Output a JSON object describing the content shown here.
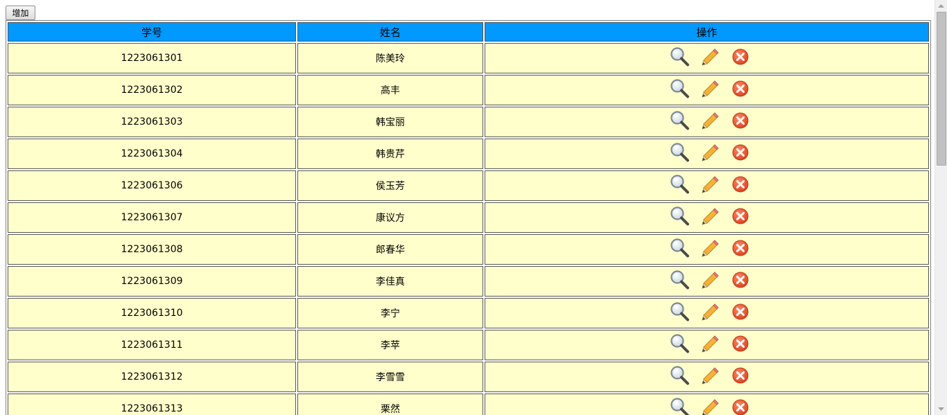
{
  "toolbar": {
    "add_label": "增加"
  },
  "table": {
    "columns": [
      "学号",
      "姓名",
      "操作"
    ],
    "rows": [
      {
        "id": "1223061301",
        "name": "陈美玲"
      },
      {
        "id": "1223061302",
        "name": "高丰"
      },
      {
        "id": "1223061303",
        "name": "韩宝丽"
      },
      {
        "id": "1223061304",
        "name": "韩贵芹"
      },
      {
        "id": "1223061306",
        "name": "侯玉芳"
      },
      {
        "id": "1223061307",
        "name": "康议方"
      },
      {
        "id": "1223061308",
        "name": "郎春华"
      },
      {
        "id": "1223061309",
        "name": "李佳真"
      },
      {
        "id": "1223061310",
        "name": "李宁"
      },
      {
        "id": "1223061311",
        "name": "李苹"
      },
      {
        "id": "1223061312",
        "name": "李雪雪"
      },
      {
        "id": "1223061313",
        "name": "栗然"
      }
    ],
    "actions": [
      "view-icon",
      "edit-icon",
      "delete-icon"
    ]
  },
  "colors": {
    "header_bg": "#0099ff",
    "row_bg": "#ffffcc",
    "delete_icon": "#e8522c",
    "edit_icon": "#f0a830"
  }
}
